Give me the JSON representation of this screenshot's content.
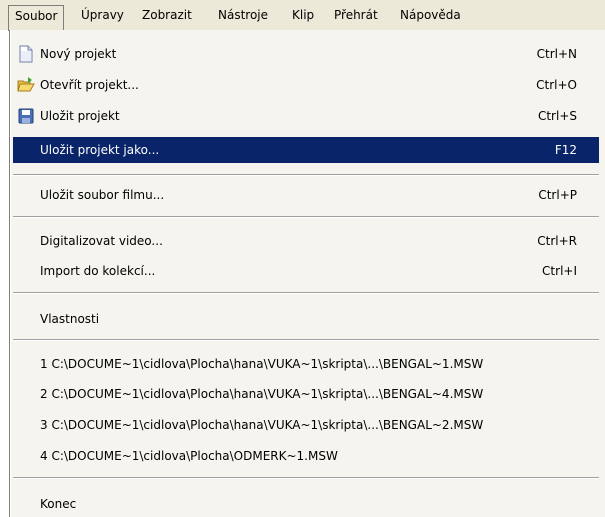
{
  "menubar": {
    "items": [
      "Soubor",
      "Úpravy",
      "Zobrazit",
      "Nástroje",
      "Klip",
      "Přehrát",
      "Nápověda"
    ]
  },
  "menu": {
    "items": [
      {
        "label": "Nový projekt",
        "shortcut": "Ctrl+N",
        "icon": "new-document-icon"
      },
      {
        "label": "Otevřít projekt...",
        "shortcut": "Ctrl+O",
        "icon": "open-folder-icon"
      },
      {
        "label": "Uložit projekt",
        "shortcut": "Ctrl+S",
        "icon": "save-disk-icon"
      },
      {
        "label": "Uložit projekt jako...",
        "shortcut": "F12",
        "selected": true
      },
      {
        "label": "Uložit soubor filmu...",
        "shortcut": "Ctrl+P"
      },
      {
        "label": "Digitalizovat video...",
        "shortcut": "Ctrl+R"
      },
      {
        "label": "Import do kolekcí...",
        "shortcut": "Ctrl+I"
      },
      {
        "label": "Vlastnosti"
      },
      {
        "label": "1 C:\\DOCUME~1\\cidlova\\Plocha\\hana\\VUKA~1\\skripta\\...\\BENGAL~1.MSW"
      },
      {
        "label": "2 C:\\DOCUME~1\\cidlova\\Plocha\\hana\\VUKA~1\\skripta\\...\\BENGAL~4.MSW"
      },
      {
        "label": "3 C:\\DOCUME~1\\cidlova\\Plocha\\hana\\VUKA~1\\skripta\\...\\BENGAL~2.MSW"
      },
      {
        "label": "4 C:\\DOCUME~1\\cidlova\\Plocha\\ODMERK~1.MSW"
      },
      {
        "label": "Konec"
      }
    ]
  },
  "colors": {
    "highlight": "#0a246a",
    "menu_bg": "#f5f4ee",
    "menubar_bg": "#ece9d8"
  }
}
